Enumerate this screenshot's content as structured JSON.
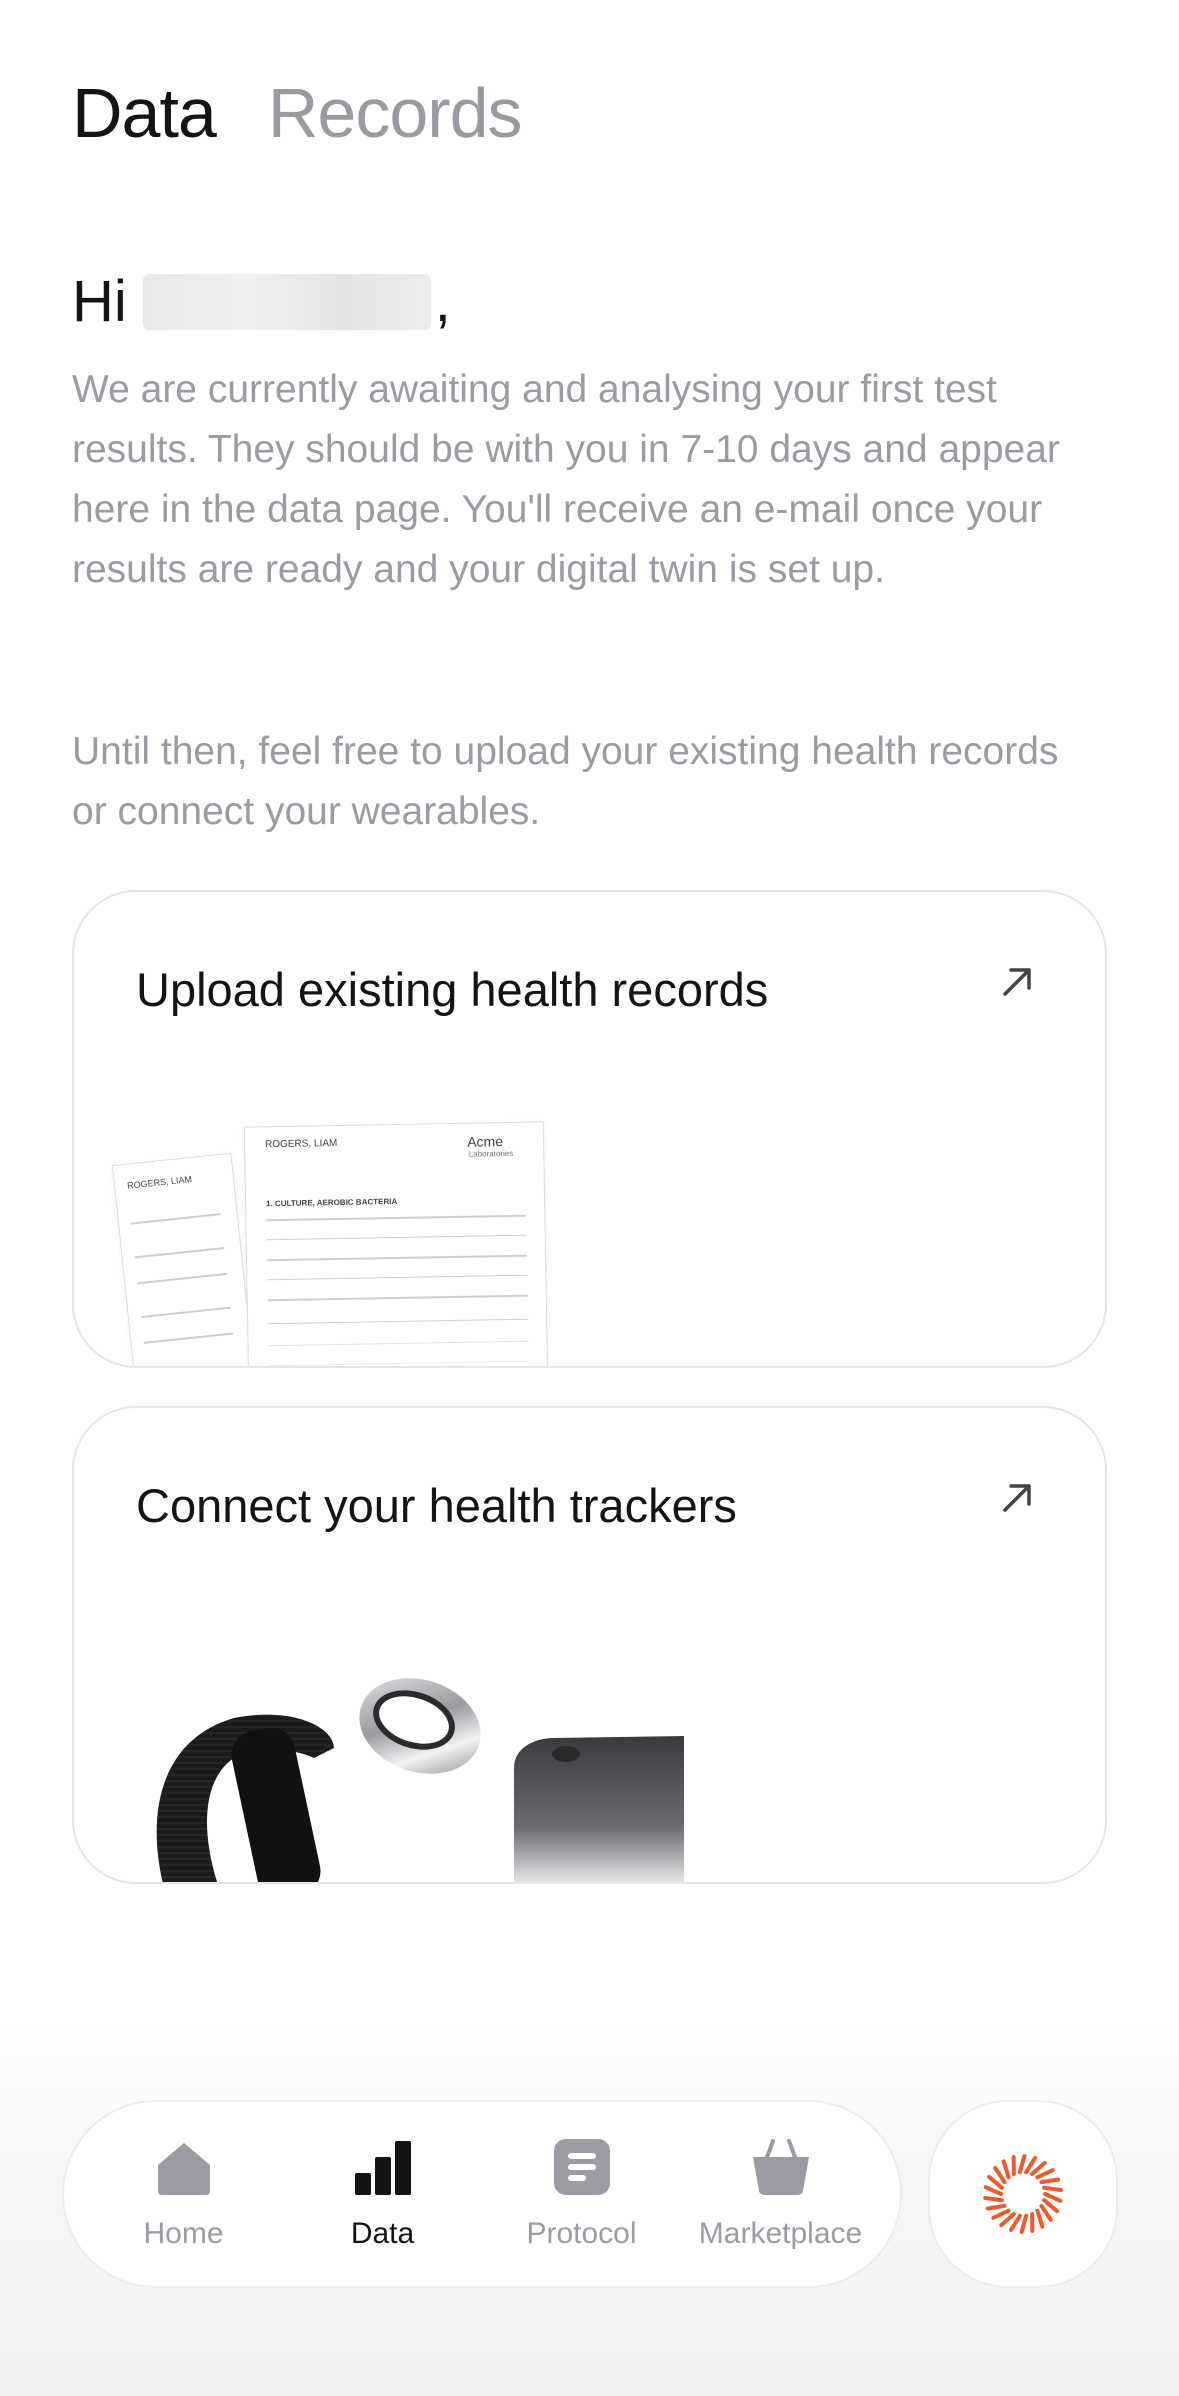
{
  "header": {
    "tabs": [
      {
        "label": "Data",
        "active": true
      },
      {
        "label": "Records",
        "active": false
      }
    ]
  },
  "greeting": {
    "prefix": "Hi",
    "suffix": ","
  },
  "intro": {
    "paragraph1": "We are currently awaiting and analysing your first test results. They should be with you in 7-10 days and appear here in the data page. You'll receive an e-mail once your results are ready and your digital twin is set up.",
    "paragraph2": "Until then, feel free to upload your existing health records or connect your wearables."
  },
  "cards": {
    "records": {
      "title": "Upload existing health records",
      "icon": "arrow-up-right-icon",
      "doc": {
        "patient": "ROGERS, LIAM",
        "lab_name": "Acme",
        "lab_sub": "Laboratories",
        "section": "1. CULTURE, AEROBIC BACTERIA"
      }
    },
    "trackers": {
      "title": "Connect your health trackers",
      "icon": "arrow-up-right-icon"
    }
  },
  "nav": {
    "items": [
      {
        "label": "Home",
        "icon": "home-icon",
        "active": false
      },
      {
        "label": "Data",
        "icon": "bar-chart-icon",
        "active": true
      },
      {
        "label": "Protocol",
        "icon": "document-icon",
        "active": false
      },
      {
        "label": "Marketplace",
        "icon": "basket-icon",
        "active": false
      }
    ],
    "fab_icon": "sunburst-icon"
  },
  "colors": {
    "accent": "#ee5a2c",
    "muted_text": "#9b9ba3",
    "primary_text": "#141414"
  }
}
